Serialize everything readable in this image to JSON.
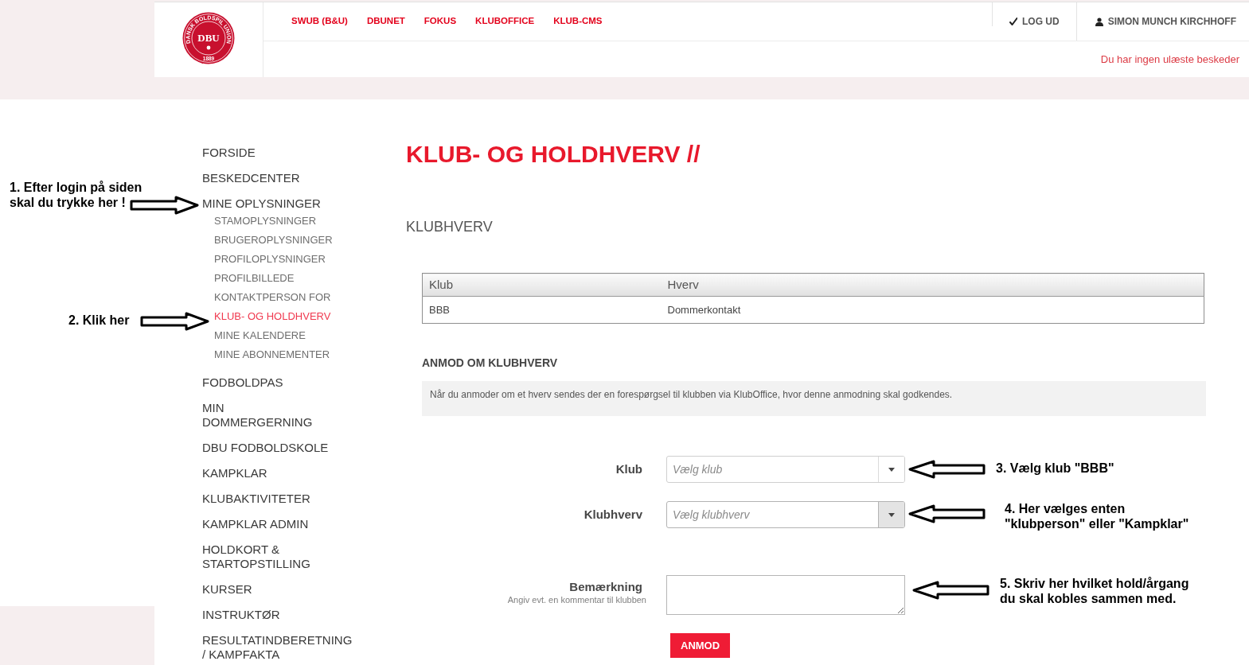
{
  "header": {
    "logo": {
      "ring_text": "DANSK BOLDSPIL UNION",
      "monogram": "DBU",
      "year": "1889"
    },
    "nav_links": [
      "SWUB (B&U)",
      "DBUNET",
      "FOKUS",
      "KLUBOFFICE",
      "KLUB-CMS"
    ],
    "logout": "LOG UD",
    "user": "SIMON MUNCH KIRCHHOFF",
    "messages": "Du har ingen ulæste beskeder"
  },
  "sidebar": {
    "items": [
      {
        "label": "FORSIDE",
        "selected": false
      },
      {
        "label": "BESKEDCENTER",
        "selected": false
      },
      {
        "label": "MINE OPLYSNINGER",
        "selected": false,
        "children": [
          {
            "label": "STAMOPLYSNINGER",
            "selected": false
          },
          {
            "label": "BRUGEROPLYSNINGER",
            "selected": false
          },
          {
            "label": "PROFILOPLYSNINGER",
            "selected": false
          },
          {
            "label": "PROFILBILLEDE",
            "selected": false
          },
          {
            "label": "KONTAKTPERSON FOR",
            "selected": false
          },
          {
            "label": "KLUB- OG HOLDHVERV",
            "selected": true
          },
          {
            "label": "MINE KALENDERE",
            "selected": false
          },
          {
            "label": "MINE ABONNEMENTER",
            "selected": false
          }
        ]
      },
      {
        "label": "FODBOLDPAS",
        "selected": false
      },
      {
        "label": "MIN\nDOMMERGERNING",
        "selected": false
      },
      {
        "label": "DBU FODBOLDSKOLE",
        "selected": false
      },
      {
        "label": "KAMPKLAR",
        "selected": false
      },
      {
        "label": "KLUBAKTIVITETER",
        "selected": false
      },
      {
        "label": "KAMPKLAR ADMIN",
        "selected": false
      },
      {
        "label": "HOLDKORT &\nSTARTOPSTILLING",
        "selected": false
      },
      {
        "label": "KURSER",
        "selected": false
      },
      {
        "label": "INSTRUKTØR",
        "selected": false
      },
      {
        "label": "RESULTATINDBERETNING\n/ KAMPFAKTA",
        "selected": false
      }
    ]
  },
  "page": {
    "title": "KLUB- OG HOLDHVERV //",
    "section_title": "KLUBHVERV",
    "table": {
      "columns": [
        "Klub",
        "Hverv"
      ],
      "rows": [
        [
          "BBB",
          "Dommerkontakt"
        ]
      ]
    },
    "request": {
      "title": "ANMOD OM KLUBHVERV",
      "info": "Når du anmoder om et hverv sendes der en forespørgsel til klubben via KlubOffice, hvor denne anmodning skal godkendes.",
      "fields": [
        {
          "kind": "select",
          "label": "Klub",
          "placeholder": "Vælg klub",
          "highlighted": false
        },
        {
          "kind": "select",
          "label": "Klubhverv",
          "placeholder": "Vælg klubhverv",
          "highlighted": true
        },
        {
          "kind": "textarea",
          "label": "Bemærkning",
          "hint": "Angiv evt. en kommentar til klubben"
        }
      ],
      "submit": "ANMOD"
    }
  },
  "annotations": [
    {
      "kind": "right",
      "text": "1. Efter login på siden\nskal du trykke her !"
    },
    {
      "kind": "right",
      "text": "2. Klik her"
    },
    {
      "kind": "left",
      "text": "3. Vælg klub \"BBB\""
    },
    {
      "kind": "left",
      "text": "4. Her vælges enten\n\"klubperson\" eller \"Kampklar\""
    },
    {
      "kind": "left",
      "text": "5. Skriv her hvilket hold/årgang\ndu skal kobles sammen med."
    }
  ]
}
